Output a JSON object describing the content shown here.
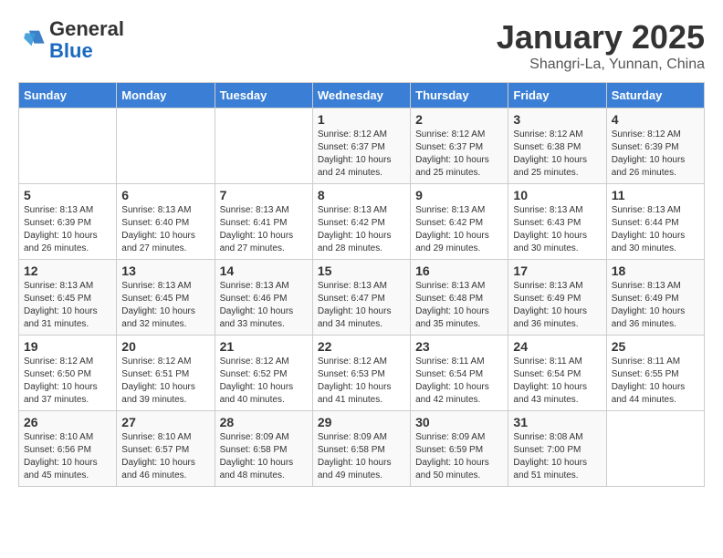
{
  "header": {
    "logo_line1": "General",
    "logo_line2": "Blue",
    "month": "January 2025",
    "location": "Shangri-La, Yunnan, China"
  },
  "weekdays": [
    "Sunday",
    "Monday",
    "Tuesday",
    "Wednesday",
    "Thursday",
    "Friday",
    "Saturday"
  ],
  "weeks": [
    [
      {
        "day": "",
        "info": ""
      },
      {
        "day": "",
        "info": ""
      },
      {
        "day": "",
        "info": ""
      },
      {
        "day": "1",
        "info": "Sunrise: 8:12 AM\nSunset: 6:37 PM\nDaylight: 10 hours\nand 24 minutes."
      },
      {
        "day": "2",
        "info": "Sunrise: 8:12 AM\nSunset: 6:37 PM\nDaylight: 10 hours\nand 25 minutes."
      },
      {
        "day": "3",
        "info": "Sunrise: 8:12 AM\nSunset: 6:38 PM\nDaylight: 10 hours\nand 25 minutes."
      },
      {
        "day": "4",
        "info": "Sunrise: 8:12 AM\nSunset: 6:39 PM\nDaylight: 10 hours\nand 26 minutes."
      }
    ],
    [
      {
        "day": "5",
        "info": "Sunrise: 8:13 AM\nSunset: 6:39 PM\nDaylight: 10 hours\nand 26 minutes."
      },
      {
        "day": "6",
        "info": "Sunrise: 8:13 AM\nSunset: 6:40 PM\nDaylight: 10 hours\nand 27 minutes."
      },
      {
        "day": "7",
        "info": "Sunrise: 8:13 AM\nSunset: 6:41 PM\nDaylight: 10 hours\nand 27 minutes."
      },
      {
        "day": "8",
        "info": "Sunrise: 8:13 AM\nSunset: 6:42 PM\nDaylight: 10 hours\nand 28 minutes."
      },
      {
        "day": "9",
        "info": "Sunrise: 8:13 AM\nSunset: 6:42 PM\nDaylight: 10 hours\nand 29 minutes."
      },
      {
        "day": "10",
        "info": "Sunrise: 8:13 AM\nSunset: 6:43 PM\nDaylight: 10 hours\nand 30 minutes."
      },
      {
        "day": "11",
        "info": "Sunrise: 8:13 AM\nSunset: 6:44 PM\nDaylight: 10 hours\nand 30 minutes."
      }
    ],
    [
      {
        "day": "12",
        "info": "Sunrise: 8:13 AM\nSunset: 6:45 PM\nDaylight: 10 hours\nand 31 minutes."
      },
      {
        "day": "13",
        "info": "Sunrise: 8:13 AM\nSunset: 6:45 PM\nDaylight: 10 hours\nand 32 minutes."
      },
      {
        "day": "14",
        "info": "Sunrise: 8:13 AM\nSunset: 6:46 PM\nDaylight: 10 hours\nand 33 minutes."
      },
      {
        "day": "15",
        "info": "Sunrise: 8:13 AM\nSunset: 6:47 PM\nDaylight: 10 hours\nand 34 minutes."
      },
      {
        "day": "16",
        "info": "Sunrise: 8:13 AM\nSunset: 6:48 PM\nDaylight: 10 hours\nand 35 minutes."
      },
      {
        "day": "17",
        "info": "Sunrise: 8:13 AM\nSunset: 6:49 PM\nDaylight: 10 hours\nand 36 minutes."
      },
      {
        "day": "18",
        "info": "Sunrise: 8:13 AM\nSunset: 6:49 PM\nDaylight: 10 hours\nand 36 minutes."
      }
    ],
    [
      {
        "day": "19",
        "info": "Sunrise: 8:12 AM\nSunset: 6:50 PM\nDaylight: 10 hours\nand 37 minutes."
      },
      {
        "day": "20",
        "info": "Sunrise: 8:12 AM\nSunset: 6:51 PM\nDaylight: 10 hours\nand 39 minutes."
      },
      {
        "day": "21",
        "info": "Sunrise: 8:12 AM\nSunset: 6:52 PM\nDaylight: 10 hours\nand 40 minutes."
      },
      {
        "day": "22",
        "info": "Sunrise: 8:12 AM\nSunset: 6:53 PM\nDaylight: 10 hours\nand 41 minutes."
      },
      {
        "day": "23",
        "info": "Sunrise: 8:11 AM\nSunset: 6:54 PM\nDaylight: 10 hours\nand 42 minutes."
      },
      {
        "day": "24",
        "info": "Sunrise: 8:11 AM\nSunset: 6:54 PM\nDaylight: 10 hours\nand 43 minutes."
      },
      {
        "day": "25",
        "info": "Sunrise: 8:11 AM\nSunset: 6:55 PM\nDaylight: 10 hours\nand 44 minutes."
      }
    ],
    [
      {
        "day": "26",
        "info": "Sunrise: 8:10 AM\nSunset: 6:56 PM\nDaylight: 10 hours\nand 45 minutes."
      },
      {
        "day": "27",
        "info": "Sunrise: 8:10 AM\nSunset: 6:57 PM\nDaylight: 10 hours\nand 46 minutes."
      },
      {
        "day": "28",
        "info": "Sunrise: 8:09 AM\nSunset: 6:58 PM\nDaylight: 10 hours\nand 48 minutes."
      },
      {
        "day": "29",
        "info": "Sunrise: 8:09 AM\nSunset: 6:58 PM\nDaylight: 10 hours\nand 49 minutes."
      },
      {
        "day": "30",
        "info": "Sunrise: 8:09 AM\nSunset: 6:59 PM\nDaylight: 10 hours\nand 50 minutes."
      },
      {
        "day": "31",
        "info": "Sunrise: 8:08 AM\nSunset: 7:00 PM\nDaylight: 10 hours\nand 51 minutes."
      },
      {
        "day": "",
        "info": ""
      }
    ]
  ]
}
